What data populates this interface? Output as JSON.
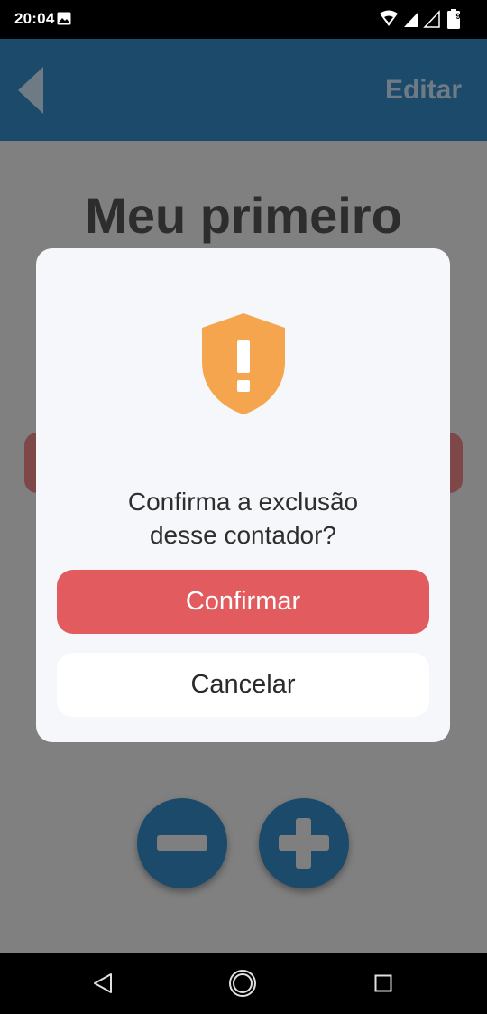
{
  "status_bar": {
    "time": "20:04",
    "battery_level": "91",
    "icons": [
      "photo-icon",
      "wifi-icon",
      "signal-icon",
      "signal-empty-icon",
      "battery-icon"
    ]
  },
  "header": {
    "back_icon": "back-arrow-icon",
    "edit_label": "Editar",
    "background_color": "#1c4a6a"
  },
  "content": {
    "counter_title": "Meu primeiro",
    "decrement_icon": "minus-icon",
    "increment_icon": "plus-icon"
  },
  "dialog": {
    "icon": "shield-warning-icon",
    "icon_color": "#f4a54e",
    "message_line1": "Confirma a exclusão",
    "message_line2": "desse contador?",
    "confirm_label": "Confirmar",
    "confirm_color": "#e25b5e",
    "cancel_label": "Cancelar"
  },
  "nav_bar": {
    "icons": [
      "nav-back-icon",
      "nav-home-icon",
      "nav-recents-icon"
    ]
  }
}
